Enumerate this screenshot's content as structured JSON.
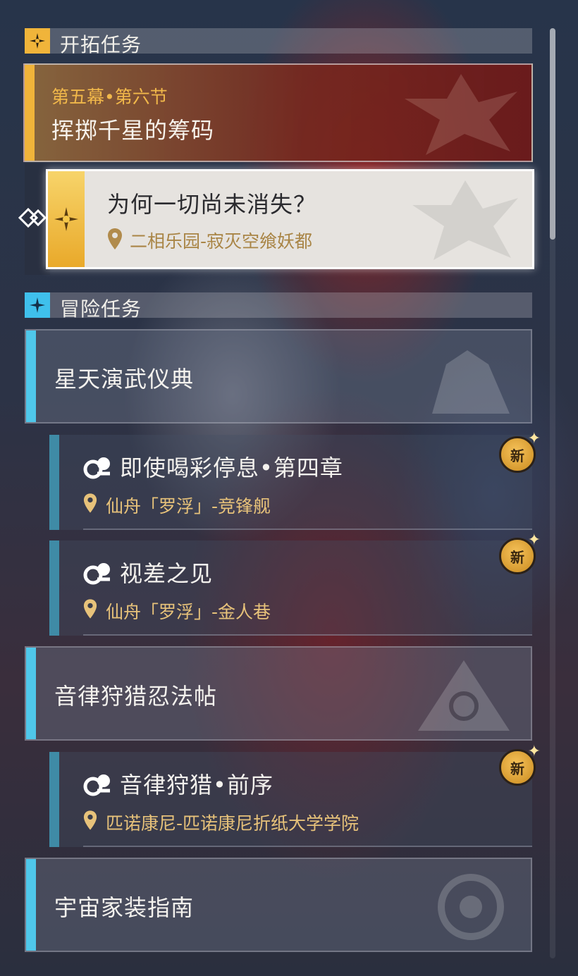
{
  "trailblaze": {
    "header": "开拓任务",
    "chapter": "第五幕•第六节",
    "title": "挥掷千星的筹码",
    "current": {
      "title": "为何一切尚未消失？",
      "location": "二相乐园-寂灭空飨妖都"
    }
  },
  "adventure": {
    "header": "冒险任务",
    "groups": [
      {
        "name": "星天演武仪典",
        "quests": [
          {
            "title": "即使喝彩停息•第四章",
            "location": "仙舟「罗浮」-竞锋舰",
            "badge": "新"
          },
          {
            "title": "视差之见",
            "location": "仙舟「罗浮」-金人巷",
            "badge": "新"
          }
        ]
      },
      {
        "name": "音律狩猎忍法帖",
        "quests": [
          {
            "title": "音律狩猎•前序",
            "location": "匹诺康尼-匹诺康尼折纸大学学院",
            "badge": "新"
          }
        ]
      },
      {
        "name": "宇宙家装指南",
        "quests": []
      }
    ]
  },
  "colors": {
    "gold": "#e7c27a",
    "cyan_bar": "#4fc7ea",
    "teal_bar": "#3f8ba6",
    "crimson": "#7a1a1a"
  }
}
